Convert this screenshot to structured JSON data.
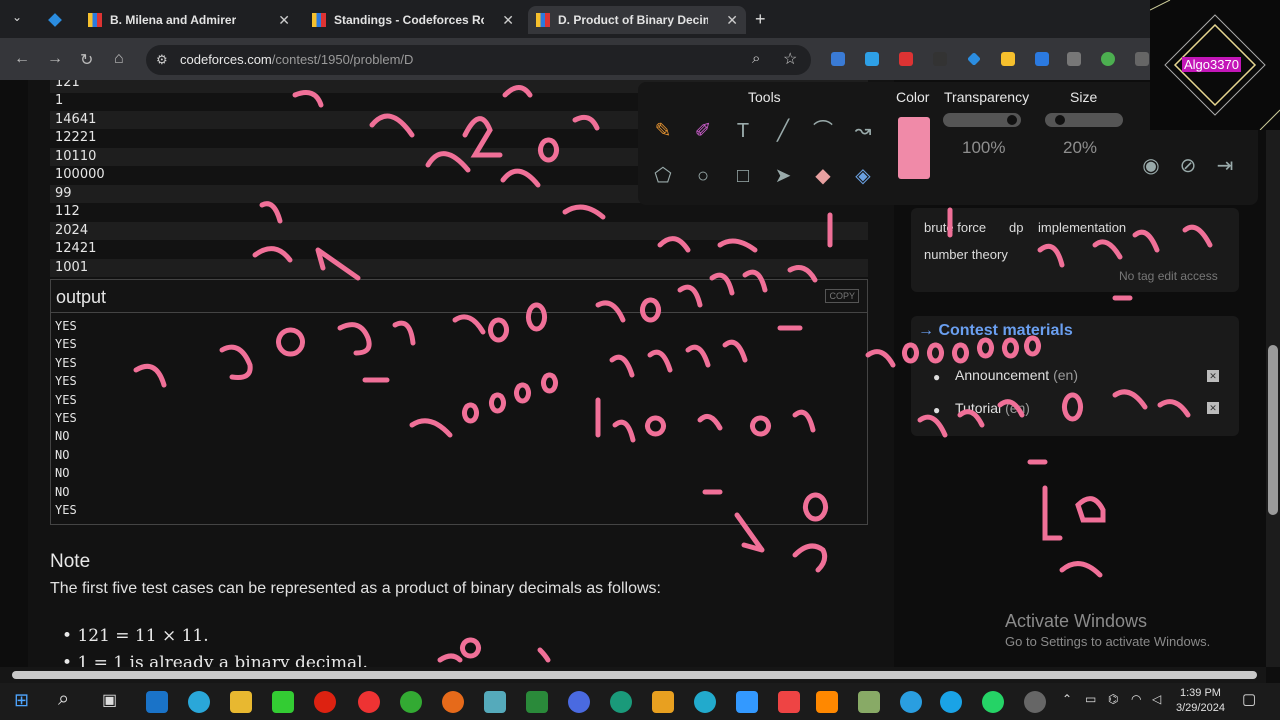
{
  "browser": {
    "tabs": [
      {
        "label": "B. Milena and Admirer",
        "active": false
      },
      {
        "label": "Standings - Codeforces Round",
        "active": false
      },
      {
        "label": "D. Product of Binary Decimals",
        "active": true
      }
    ],
    "new_tab": "+",
    "url_host": "codeforces.com",
    "url_path": "/contest/1950/problem/D"
  },
  "problem": {
    "input_rows": [
      "121",
      "1",
      "14641",
      "12221",
      "10110",
      "100000",
      "99",
      "112",
      "2024",
      "12421",
      "1001"
    ],
    "output_label": "output",
    "copy_label": "COPY",
    "output_rows": [
      "YES",
      "YES",
      "YES",
      "YES",
      "YES",
      "YES",
      "NO",
      "NO",
      "NO",
      "NO",
      "YES"
    ],
    "note_title": "Note",
    "note_text": "The first five test cases can be represented as a product of binary decimals as follows:",
    "note_items": [
      "121 = 11 × 11.",
      "1 = 1 is already a binary decimal."
    ]
  },
  "sidebar": {
    "tags": [
      "brute force",
      "dp",
      "implementation",
      "number theory"
    ],
    "no_tag_edit": "No tag edit access",
    "materials_title": "→ Contest materials",
    "materials": [
      {
        "label": "Announcement",
        "lang": "(en)"
      },
      {
        "label": "Tutorial",
        "lang": "(en)"
      }
    ],
    "activate_title": "Activate Windows",
    "activate_sub": "Go to Settings to activate Windows."
  },
  "tools_panel": {
    "tools_label": "Tools",
    "color_label": "Color",
    "transparency_label": "Transparency",
    "transparency_value": "100%",
    "size_label": "Size",
    "size_value": "20%",
    "color": "#f08aa8"
  },
  "overlay": {
    "channel_name": "Algo3370"
  },
  "taskbar": {
    "time": "1:39 PM",
    "date": "3/29/2024"
  }
}
